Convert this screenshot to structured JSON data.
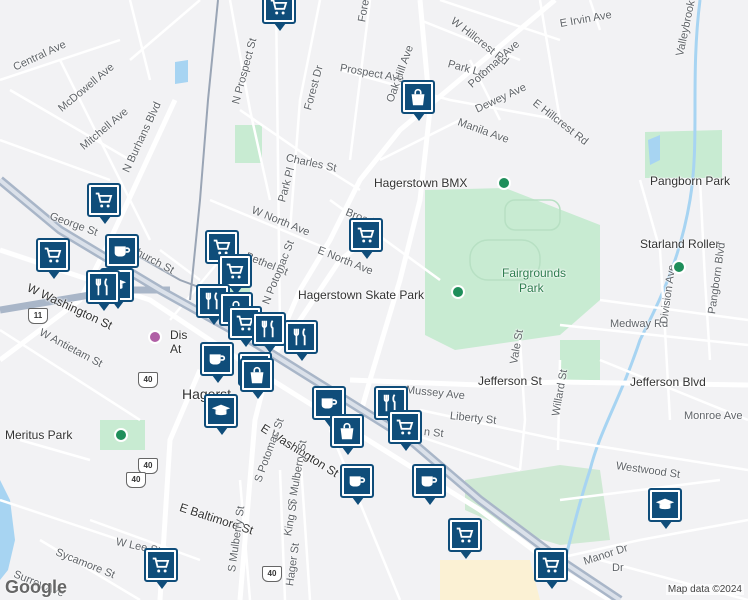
{
  "map": {
    "copyright": "Map data ©2024",
    "logo": "Google",
    "colors": {
      "land": "#f2f2f4",
      "park": "#c8ebd2",
      "water": "#a7d4f2",
      "road": "#ffffff",
      "rail": "#8a98ad",
      "poi_pin": "#0f4d7a",
      "green_poi": "#1e8e5a"
    },
    "place_labels": [
      {
        "id": "hagerstown-bmx",
        "text": "Hagerstown BMX"
      },
      {
        "id": "pangborn-park",
        "text": "Pangborn Park"
      },
      {
        "id": "starland-roller",
        "text": "Starland Roller"
      },
      {
        "id": "fairgrounds-park-1",
        "text": "Fairgrounds"
      },
      {
        "id": "fairgrounds-park-2",
        "text": "Park"
      },
      {
        "id": "skate-park",
        "text": "Hagerstown Skate Park"
      },
      {
        "id": "meritus-park",
        "text": "Meritus Park"
      },
      {
        "id": "hagerstown",
        "text": "Hagerst"
      },
      {
        "id": "district",
        "text": "Dis"
      },
      {
        "id": "district-at",
        "text": "At"
      }
    ],
    "street_labels": [
      {
        "id": "forest-dr-top",
        "text": "Forest"
      },
      {
        "id": "w-hillcrest-rd",
        "text": "W Hillcrest Rd"
      },
      {
        "id": "e-irvin-ave",
        "text": "E Irvin Ave"
      },
      {
        "id": "valleybrook-dr",
        "text": "Valleybrook Dr"
      },
      {
        "id": "central-ave",
        "text": "Central Ave"
      },
      {
        "id": "mcdowell-ave",
        "text": "McDowell Ave"
      },
      {
        "id": "n-burhans-blvd",
        "text": "N Burhans Blvd"
      },
      {
        "id": "mitchell-ave",
        "text": "Mitchell Ave"
      },
      {
        "id": "n-prospect-st",
        "text": "N Prospect St"
      },
      {
        "id": "forest-dr",
        "text": "Forest Dr"
      },
      {
        "id": "prospect-ave",
        "text": "Prospect Ave"
      },
      {
        "id": "oak-hill-ave",
        "text": "Oak Hill Ave"
      },
      {
        "id": "park-ln",
        "text": "Park Ln"
      },
      {
        "id": "potomac-ave",
        "text": "Potomac Ave"
      },
      {
        "id": "e-hillcrest-rd",
        "text": "E Hillcrest Rd"
      },
      {
        "id": "dewey-ave",
        "text": "Dewey Ave"
      },
      {
        "id": "manila-ave",
        "text": "Manila Ave"
      },
      {
        "id": "charles-st",
        "text": "Charles St"
      },
      {
        "id": "park-pl",
        "text": "Park Pl"
      },
      {
        "id": "george-st",
        "text": "George St"
      },
      {
        "id": "w-church-st",
        "text": "W Church St"
      },
      {
        "id": "w-north-ave",
        "text": "W North Ave"
      },
      {
        "id": "broadway",
        "text": "Broadw"
      },
      {
        "id": "e-north-ave",
        "text": "E North Ave"
      },
      {
        "id": "bethel-st",
        "text": "Bethel St"
      },
      {
        "id": "n-potomac-st",
        "text": "N Potomac St"
      },
      {
        "id": "w-washington-st",
        "text": "W Washington St"
      },
      {
        "id": "w-antietam-st",
        "text": "W Antietam St"
      },
      {
        "id": "medway-rd",
        "text": "Medway Rd"
      },
      {
        "id": "division-ave",
        "text": "Division Ave"
      },
      {
        "id": "pangborn-blvd",
        "text": "Pangborn Blvd"
      },
      {
        "id": "vale-st",
        "text": "Vale St"
      },
      {
        "id": "jefferson-st",
        "text": "Jefferson St"
      },
      {
        "id": "jefferson-blvd",
        "text": "Jefferson Blvd"
      },
      {
        "id": "mussey-ave",
        "text": "Mussey Ave"
      },
      {
        "id": "liberty-st",
        "text": "Liberty St"
      },
      {
        "id": "willard-st",
        "text": "Willard St"
      },
      {
        "id": "monroe-ave",
        "text": "Monroe Ave"
      },
      {
        "id": "e-washington-st",
        "text": "E Washington St"
      },
      {
        "id": "westwood-st",
        "text": "Westwood St"
      },
      {
        "id": "e-baltimore-st",
        "text": "E Baltimore St"
      },
      {
        "id": "s-potomac-st",
        "text": "S Potomac St"
      },
      {
        "id": "s-mulberry-st",
        "text": "S Mulberry St"
      },
      {
        "id": "king-st",
        "text": "King St"
      },
      {
        "id": "w-lee-st",
        "text": "W Lee St"
      },
      {
        "id": "sycamore-st",
        "text": "Sycamore St"
      },
      {
        "id": "surrey-ave",
        "text": "Surrey Ave"
      },
      {
        "id": "s-mulberry-st-2",
        "text": "S Mulberry St"
      },
      {
        "id": "hager-st",
        "text": "Hager St"
      },
      {
        "id": "manor-dr",
        "text": "Manor Dr"
      },
      {
        "id": "dr",
        "text": "Dr"
      },
      {
        "id": "n-st",
        "text": "n St"
      }
    ],
    "route_shields": [
      {
        "id": "rt-11",
        "text": "11"
      },
      {
        "id": "rt-40-alt-1",
        "text": "40"
      },
      {
        "id": "rt-40-alt-2",
        "text": "40"
      },
      {
        "id": "rt-40",
        "text": "40"
      },
      {
        "id": "rt-40-bottom",
        "text": "40"
      }
    ],
    "pois": [
      {
        "icon": "cart-icon",
        "category": "grocery"
      },
      {
        "icon": "shopping-bag-icon",
        "category": "shopping"
      },
      {
        "icon": "cart-icon",
        "category": "grocery"
      },
      {
        "icon": "cart-icon",
        "category": "grocery"
      },
      {
        "icon": "cup-icon",
        "category": "cafe"
      },
      {
        "icon": "cart-icon",
        "category": "grocery"
      },
      {
        "icon": "cart-icon",
        "category": "grocery"
      },
      {
        "icon": "cart-icon",
        "category": "grocery"
      },
      {
        "icon": "graduation-cap-icon",
        "category": "school"
      },
      {
        "icon": "fork-knife-icon",
        "category": "restaurant"
      },
      {
        "icon": "fork-knife-icon",
        "category": "restaurant"
      },
      {
        "icon": "shopping-bag-icon",
        "category": "shopping"
      },
      {
        "icon": "cart-icon",
        "category": "grocery"
      },
      {
        "icon": "fork-knife-icon",
        "category": "restaurant"
      },
      {
        "icon": "fork-knife-icon",
        "category": "restaurant"
      },
      {
        "icon": "cup-icon",
        "category": "cafe"
      },
      {
        "icon": "cart-icon",
        "category": "grocery"
      },
      {
        "icon": "shopping-bag-icon",
        "category": "shopping"
      },
      {
        "icon": "graduation-cap-icon",
        "category": "school"
      },
      {
        "icon": "cup-icon",
        "category": "cafe"
      },
      {
        "icon": "fork-knife-icon",
        "category": "restaurant"
      },
      {
        "icon": "shopping-bag-icon",
        "category": "shopping"
      },
      {
        "icon": "cart-icon",
        "category": "grocery"
      },
      {
        "icon": "cup-icon",
        "category": "cafe"
      },
      {
        "icon": "cup-icon",
        "category": "cafe"
      },
      {
        "icon": "cart-icon",
        "category": "grocery"
      },
      {
        "icon": "graduation-cap-icon",
        "category": "school"
      },
      {
        "icon": "cart-icon",
        "category": "grocery"
      },
      {
        "icon": "cart-icon",
        "category": "grocery"
      }
    ]
  }
}
